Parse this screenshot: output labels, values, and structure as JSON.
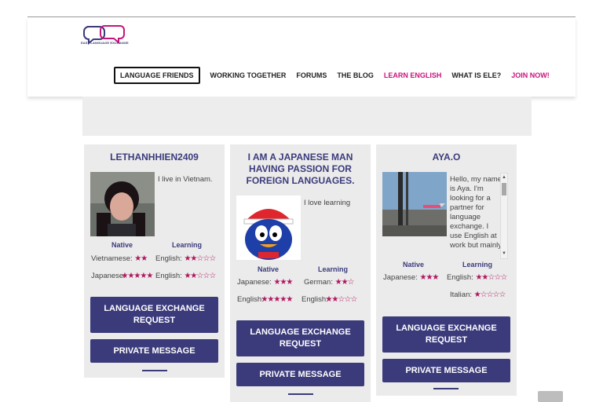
{
  "header": {
    "logo_text": "EASY LANGUAGE EXCHANGE",
    "nav": [
      {
        "label": "LANGUAGE FRIENDS",
        "active": true
      },
      {
        "label": "WORKING TOGETHER"
      },
      {
        "label": "FORUMS"
      },
      {
        "label": "THE BLOG"
      },
      {
        "label": "LEARN ENGLISH",
        "pink": true
      },
      {
        "label": "WHAT IS ELE?"
      },
      {
        "label": "JOIN NOW!",
        "pink": true
      }
    ]
  },
  "labels": {
    "native": "Native",
    "learning": "Learning",
    "exchange_button": "LANGUAGE EXCHANGE REQUEST",
    "message_button": "PRIVATE MESSAGE"
  },
  "cards": [
    {
      "title": "LETHANHHIEN2409",
      "bio": "I live in Vietnam.",
      "native": [
        {
          "lang": "Vietnamese:",
          "stars": "★★"
        },
        {
          "lang": "Japanese:",
          "stars": "★★★★★"
        }
      ],
      "learning": [
        {
          "lang": "English:",
          "stars": "★★☆☆☆"
        },
        {
          "lang": "English:",
          "stars": "★★☆☆☆"
        }
      ]
    },
    {
      "title": "I AM A JAPANESE MAN HAVING PASSION FOR FOREIGN LANGUAGES.",
      "bio": "I love learning",
      "native": [
        {
          "lang": "Japanese:",
          "stars": "★★★"
        },
        {
          "lang": "English:",
          "stars": "★★★★★"
        }
      ],
      "learning": [
        {
          "lang": "German:",
          "stars": "★★☆"
        },
        {
          "lang": "English:",
          "stars": "★★☆☆☆"
        }
      ]
    },
    {
      "title": "AYA.O",
      "bio": "Hello, my name is Aya. I'm looking for a partner for language exchange. I use English at work but mainly",
      "native": [
        {
          "lang": "Japanese:",
          "stars": "★★★"
        }
      ],
      "learning": [
        {
          "lang": "English:",
          "stars": "★★☆☆☆"
        },
        {
          "lang": "Italian:",
          "stars": "★☆☆☆☆"
        }
      ]
    }
  ],
  "colors": {
    "brand": "#3b3b7c",
    "accent": "#c7147b",
    "star": "#b0155f"
  }
}
